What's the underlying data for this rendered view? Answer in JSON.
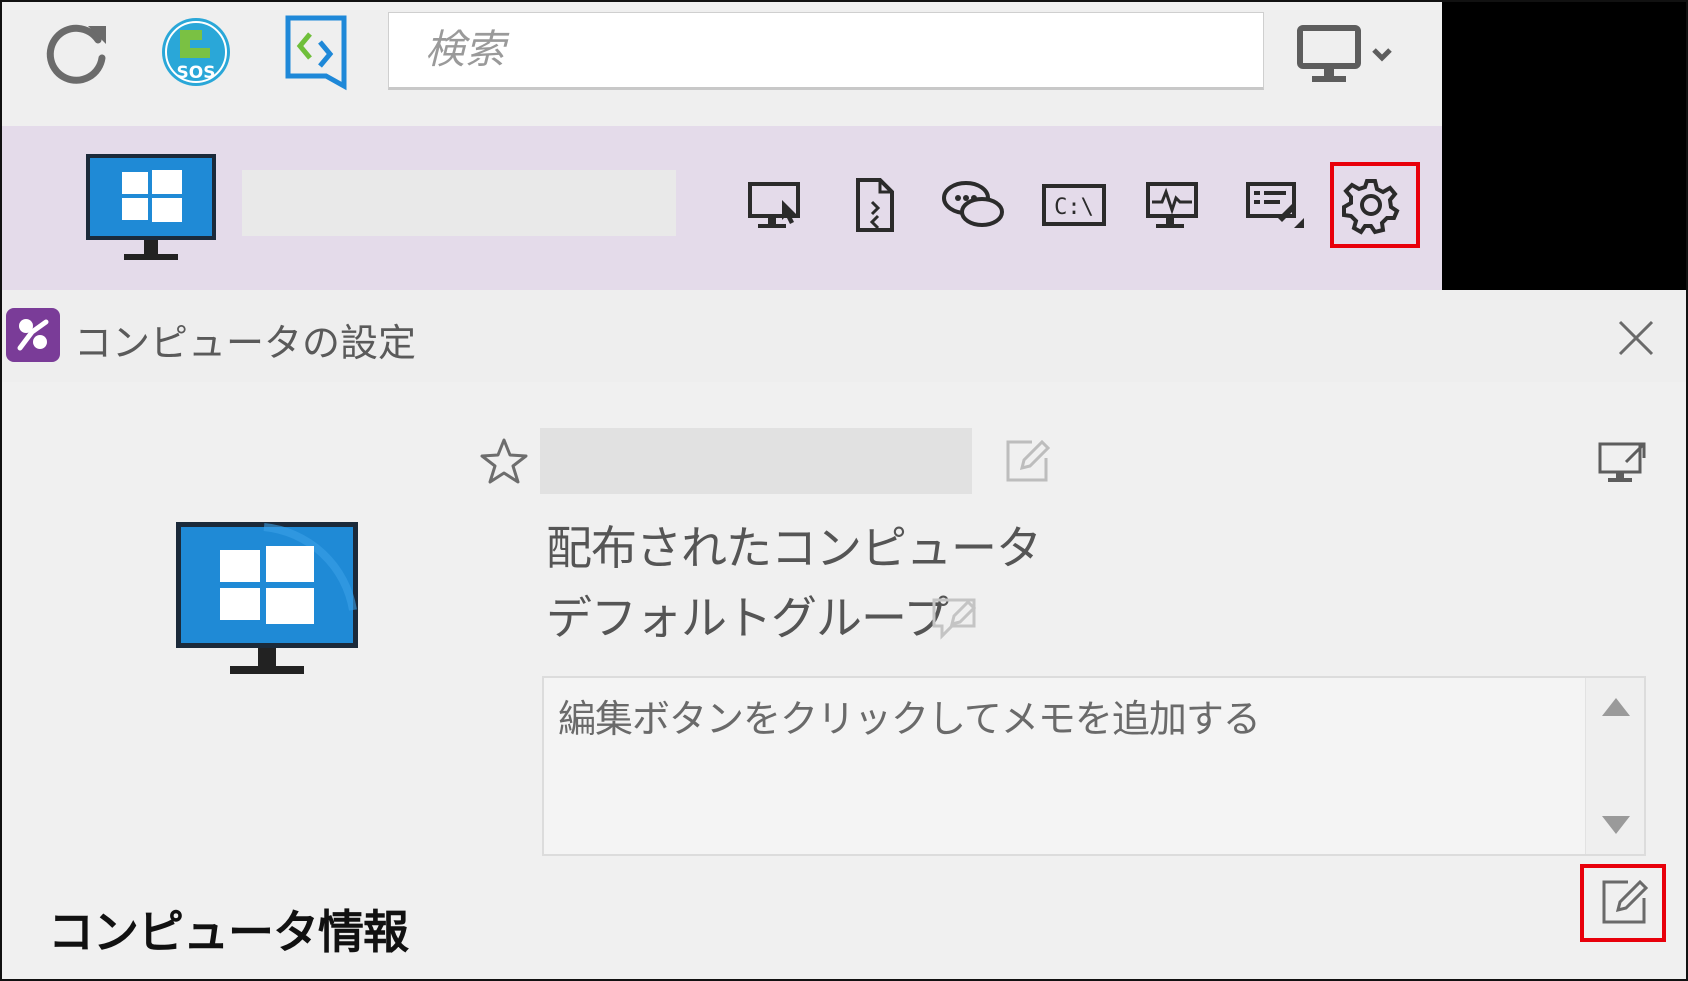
{
  "toolbar": {
    "search_placeholder": "検索",
    "sos_badge": "SOS",
    "icons": [
      "refresh-icon",
      "sos-support-icon",
      "remote-connect-icon",
      "monitor-dropdown-icon"
    ]
  },
  "computer_bar": {
    "actions": [
      "remote-control-icon",
      "file-transfer-icon",
      "chat-icon",
      "command-prompt-icon",
      "performance-monitor-icon",
      "remote-tasks-icon",
      "settings-gear-icon"
    ],
    "cmd_label": "C:\\"
  },
  "panel": {
    "title": "コンピュータの設定",
    "distributed_label": "配布されたコンピュータ",
    "group_label": "デフォルトグループ",
    "memo_placeholder": "編集ボタンをクリックしてメモを追加する",
    "section_title": "コンピュータ情報"
  },
  "colors": {
    "highlight": "#e8000b",
    "bar_background": "#e4dbea",
    "panel_background": "#f0f0f0",
    "windows_blue": "#1f8ad6"
  }
}
